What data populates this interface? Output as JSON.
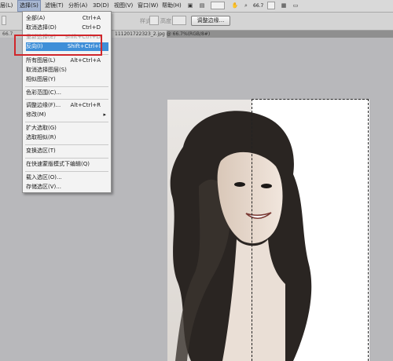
{
  "menubar": {
    "items": [
      "层(L)",
      "选择(S)",
      "滤镜(T)",
      "分析(A)",
      "3D(D)",
      "视图(V)",
      "窗口(W)",
      "帮助(H)"
    ],
    "zoom": "66.7"
  },
  "options": {
    "lbl_a": "样式",
    "lbl_b": "高度",
    "refine_edge": "调整边缘..."
  },
  "tab": {
    "left": "66.7",
    "right": "111201722323_2.jpg @ 66.7%(RGB/8#)"
  },
  "select_menu": {
    "items": [
      {
        "label": "全部(A)",
        "shortcut": "Ctrl+A"
      },
      {
        "label": "取消选择(D)",
        "shortcut": "Ctrl+D"
      },
      {
        "label": "重新选择(E)",
        "shortcut": "Shift+Ctrl+D"
      },
      {
        "label": "反向(I)",
        "shortcut": "Shift+Ctrl+I"
      },
      {
        "label": "所有图层(L)",
        "shortcut": "Alt+Ctrl+A"
      },
      {
        "label": "取消选择图层(S)",
        "shortcut": ""
      },
      {
        "label": "相似图层(Y)",
        "shortcut": ""
      },
      {
        "label": "色彩范围(C)...",
        "shortcut": ""
      },
      {
        "label": "调整边缘(F)...",
        "shortcut": "Alt+Ctrl+R"
      },
      {
        "label": "修改(M)",
        "shortcut": ""
      },
      {
        "label": "扩大选取(G)",
        "shortcut": ""
      },
      {
        "label": "选取相似(R)",
        "shortcut": ""
      },
      {
        "label": "变换选区(T)",
        "shortcut": ""
      },
      {
        "label": "在快速蒙版模式下编辑(Q)",
        "shortcut": ""
      },
      {
        "label": "载入选区(O)...",
        "shortcut": ""
      },
      {
        "label": "存储选区(V)...",
        "shortcut": ""
      }
    ]
  },
  "colors": {
    "highlight": "#3f8fd8",
    "callout": "#d0262b",
    "workspace": "#b8b8bb"
  }
}
